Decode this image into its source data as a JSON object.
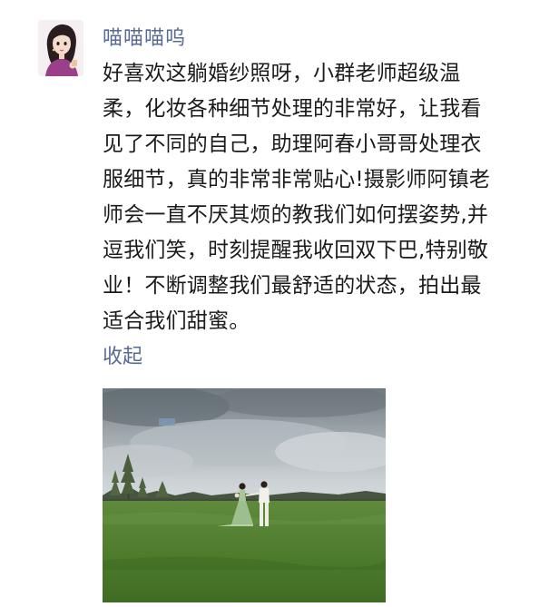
{
  "colors": {
    "name": "#586b94",
    "link": "#586b94",
    "text": "#1b1b1b"
  },
  "post": {
    "avatar_icon": "user-avatar-icon",
    "username": "喵喵喵呜",
    "content_lines": [
      "好喜欢这躺婚纱照呀，小群老师超级温",
      "柔，化妆各种细节处理的非常好，让我看",
      "见了不同的自己，助理阿春小哥哥处理衣",
      "服细节，真的非常非常贴心!摄影师阿镇老",
      "师会一直不厌其烦的教我们如何摆姿势,并",
      "逗我们笑，时刻提醒我收回双下巴,特别敬",
      "业！不断调整我们最舒适的状态，拍出最",
      "适合我们甜蜜。"
    ],
    "collapse_label": "收起",
    "photo_icon": "wedding-photo-image"
  }
}
